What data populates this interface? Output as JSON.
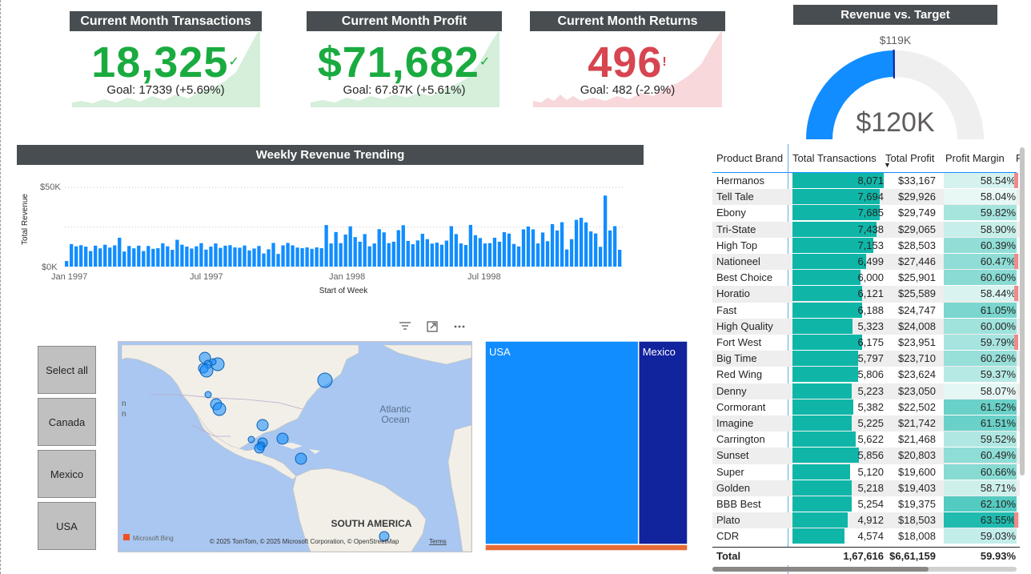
{
  "kpis": {
    "transactions": {
      "title": "Current Month Transactions",
      "value": "18,325",
      "mark": "✓",
      "goal": "Goal: 17339 (+5.69%)",
      "color": "#1aab40"
    },
    "profit": {
      "title": "Current Month Profit",
      "value": "$71,682",
      "mark": "✓",
      "goal": "Goal: 67.87K (+5.61%)",
      "color": "#1aab40"
    },
    "returns": {
      "title": "Current Month Returns",
      "value": "496",
      "mark": "!",
      "goal": "Goal: 482 (-2.9%)",
      "color": "#d64550"
    }
  },
  "gauge": {
    "title": "Revenue vs. Target",
    "target_label": "$119K",
    "value_label": "$120K",
    "value": 120,
    "target": 119,
    "max": 240,
    "fill_color": "#118dff",
    "track_color": "#f0efef"
  },
  "weekly": {
    "title": "Weekly Revenue Trending",
    "chart_data": {
      "type": "bar",
      "title": "Weekly Revenue Trending",
      "xlabel": "Start of Week",
      "ylabel": "Total Revenue",
      "ylim": [
        0,
        50000
      ],
      "y_ticks": [
        "$0K",
        "$50K"
      ],
      "x_ticks": [
        "Jan 1997",
        "Jul 1997",
        "Jan 1998",
        "Jul 1998"
      ],
      "bar_color": "#118dff",
      "values": [
        3500,
        14200,
        12800,
        13500,
        12600,
        9800,
        13200,
        11500,
        13800,
        12000,
        13400,
        18200,
        9500,
        13000,
        11500,
        13200,
        9800,
        13000,
        11200,
        11600,
        14700,
        12800,
        10600,
        16900,
        13800,
        12600,
        11400,
        12800,
        14800,
        10700,
        12600,
        14600,
        11800,
        13200,
        13500,
        12100,
        11900,
        13300,
        10200,
        11400,
        13000,
        8300,
        10900,
        14900,
        8000,
        13400,
        14900,
        13400,
        12000,
        11600,
        12100,
        11200,
        12100,
        11600,
        26200,
        14600,
        21800,
        14800,
        20200,
        25400,
        18600,
        15700,
        20500,
        12800,
        14600,
        23600,
        21600,
        14800,
        15700,
        23000,
        26100,
        16200,
        14100,
        16500,
        20700,
        17300,
        14500,
        15100,
        13800,
        16400,
        25500,
        20500,
        14600,
        13600,
        26300,
        19800,
        18000,
        14600,
        14800,
        18200,
        15700,
        21700,
        20800,
        14300,
        12700,
        23500,
        25300,
        23500,
        14600,
        21500,
        16000,
        26800,
        22800,
        28000,
        10800,
        17300,
        29500,
        30800,
        27900,
        22200,
        20900,
        12500,
        44800,
        22800,
        25500,
        10600
      ]
    }
  },
  "slicer": {
    "buttons": [
      "Select all",
      "Canada",
      "Mexico",
      "USA"
    ]
  },
  "map": {
    "labels": {
      "ocean": "Atlantic\nOcean",
      "continent": "SOUTH AMERICA",
      "bing": "Microsoft Bing",
      "copyright": "© 2025 TomTom, © 2025 Microsoft Corporation, © OpenStreetMap",
      "terms": "Terms"
    }
  },
  "treemap": {
    "chart_data": {
      "type": "treemap",
      "categories": [
        "USA",
        "Mexico",
        "Canada"
      ],
      "shares": [
        0.735,
        0.235,
        0.03
      ],
      "colors": [
        "#118dff",
        "#12239e",
        "#e66c37"
      ]
    },
    "labels": {
      "usa": "USA",
      "mexico": "Mexico"
    }
  },
  "table": {
    "headers": [
      "Product Brand",
      "Total Transactions",
      "Total Profit",
      "Profit Margin",
      "R"
    ],
    "sort_indicator": "▼",
    "chart_data": {
      "type": "table",
      "columns": [
        "Product Brand",
        "Total Transactions",
        "Total Profit",
        "Profit Margin"
      ],
      "rows": [
        [
          "Hermanos",
          "8,071",
          "$33,167",
          "58.54%"
        ],
        [
          "Tell Tale",
          "7,694",
          "$29,926",
          "58.04%"
        ],
        [
          "Ebony",
          "7,685",
          "$29,749",
          "59.82%"
        ],
        [
          "Tri-State",
          "7,438",
          "$29,065",
          "58.90%"
        ],
        [
          "High Top",
          "7,153",
          "$28,503",
          "60.39%"
        ],
        [
          "Nationeel",
          "6,499",
          "$27,446",
          "60.47%"
        ],
        [
          "Best Choice",
          "6,000",
          "$25,901",
          "60.60%"
        ],
        [
          "Horatio",
          "6,121",
          "$25,589",
          "58.44%"
        ],
        [
          "Fast",
          "6,188",
          "$24,747",
          "61.05%"
        ],
        [
          "High Quality",
          "5,323",
          "$24,008",
          "60.00%"
        ],
        [
          "Fort West",
          "6,175",
          "$23,951",
          "59.79%"
        ],
        [
          "Big Time",
          "5,797",
          "$23,710",
          "60.26%"
        ],
        [
          "Red Wing",
          "5,806",
          "$23,624",
          "59.37%"
        ],
        [
          "Denny",
          "5,223",
          "$23,050",
          "58.07%"
        ],
        [
          "Cormorant",
          "5,382",
          "$22,502",
          "61.52%"
        ],
        [
          "Imagine",
          "5,225",
          "$21,742",
          "61.51%"
        ],
        [
          "Carrington",
          "5,622",
          "$21,468",
          "59.52%"
        ],
        [
          "Sunset",
          "5,856",
          "$20,803",
          "60.49%"
        ],
        [
          "Super",
          "5,120",
          "$19,600",
          "60.66%"
        ],
        [
          "Golden",
          "5,218",
          "$19,403",
          "58.71%"
        ],
        [
          "BBB Best",
          "5,254",
          "$19,375",
          "62.10%"
        ],
        [
          "Plato",
          "4,912",
          "$18,503",
          "63.55%"
        ],
        [
          "CDR",
          "4,574",
          "$18,008",
          "59.03%"
        ]
      ],
      "transaction_values": [
        8071,
        7694,
        7685,
        7438,
        7153,
        6499,
        6000,
        6121,
        6188,
        5323,
        6175,
        5797,
        5806,
        5223,
        5382,
        5225,
        5622,
        5856,
        5120,
        5218,
        5254,
        4912,
        4574
      ],
      "margin_values": [
        58.54,
        58.04,
        59.82,
        58.9,
        60.39,
        60.47,
        60.6,
        58.44,
        61.05,
        60.0,
        59.79,
        60.26,
        59.37,
        58.07,
        61.52,
        61.51,
        59.52,
        60.49,
        60.66,
        58.71,
        62.1,
        63.55,
        59.03
      ],
      "red_flag_rows": [
        0,
        5,
        7,
        10,
        21
      ]
    },
    "total": {
      "label": "Total",
      "transactions": "1,67,616",
      "profit": "$6,61,159",
      "margin": "59.93%"
    }
  }
}
